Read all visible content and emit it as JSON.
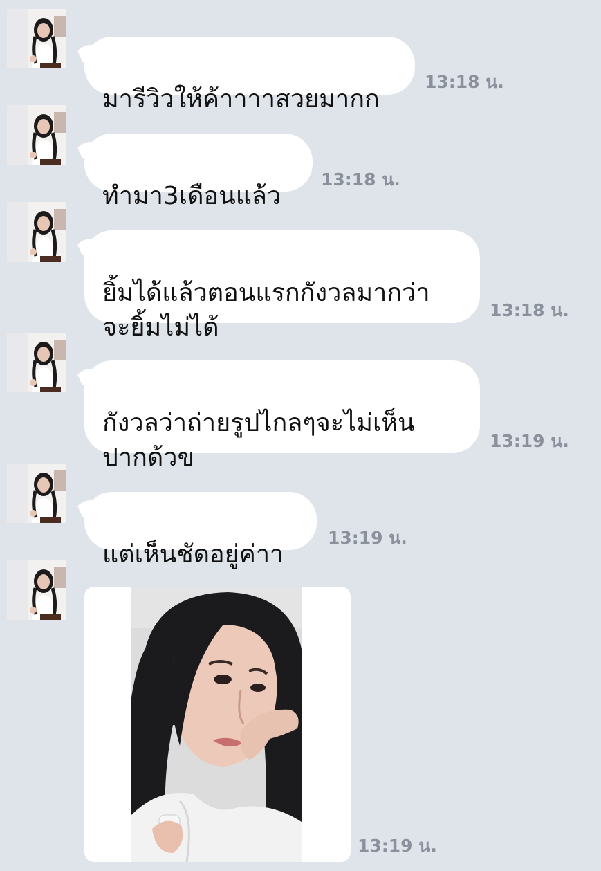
{
  "messages": [
    {
      "text": "มารีวิวให้ค้าาาาสวยมากก",
      "time": "13:18 น."
    },
    {
      "text": "ทำมา3เดือนแล้ว",
      "time": "13:18 น."
    },
    {
      "text": "ยิ้มได้แล้วตอนแรกกังวลมากว่า\nจะยิ้มไม่ได้",
      "time": "13:18 น."
    },
    {
      "text": "กังวลว่าถ่ายรูปไกลๆจะไม่เห็น\nปากด้วข",
      "time": "13:19 น."
    },
    {
      "text": "แต่เห็นชัดอยู่ค่าา",
      "time": "13:19 น."
    }
  ],
  "image_message": {
    "time": "13:19 น.",
    "type": "photo",
    "subject": "selfie-photo"
  },
  "colors": {
    "background": "#dfe3ea",
    "bubble": "#ffffff",
    "timestamp": "#8a919c"
  },
  "icons": {
    "avatar": "sender-avatar"
  }
}
